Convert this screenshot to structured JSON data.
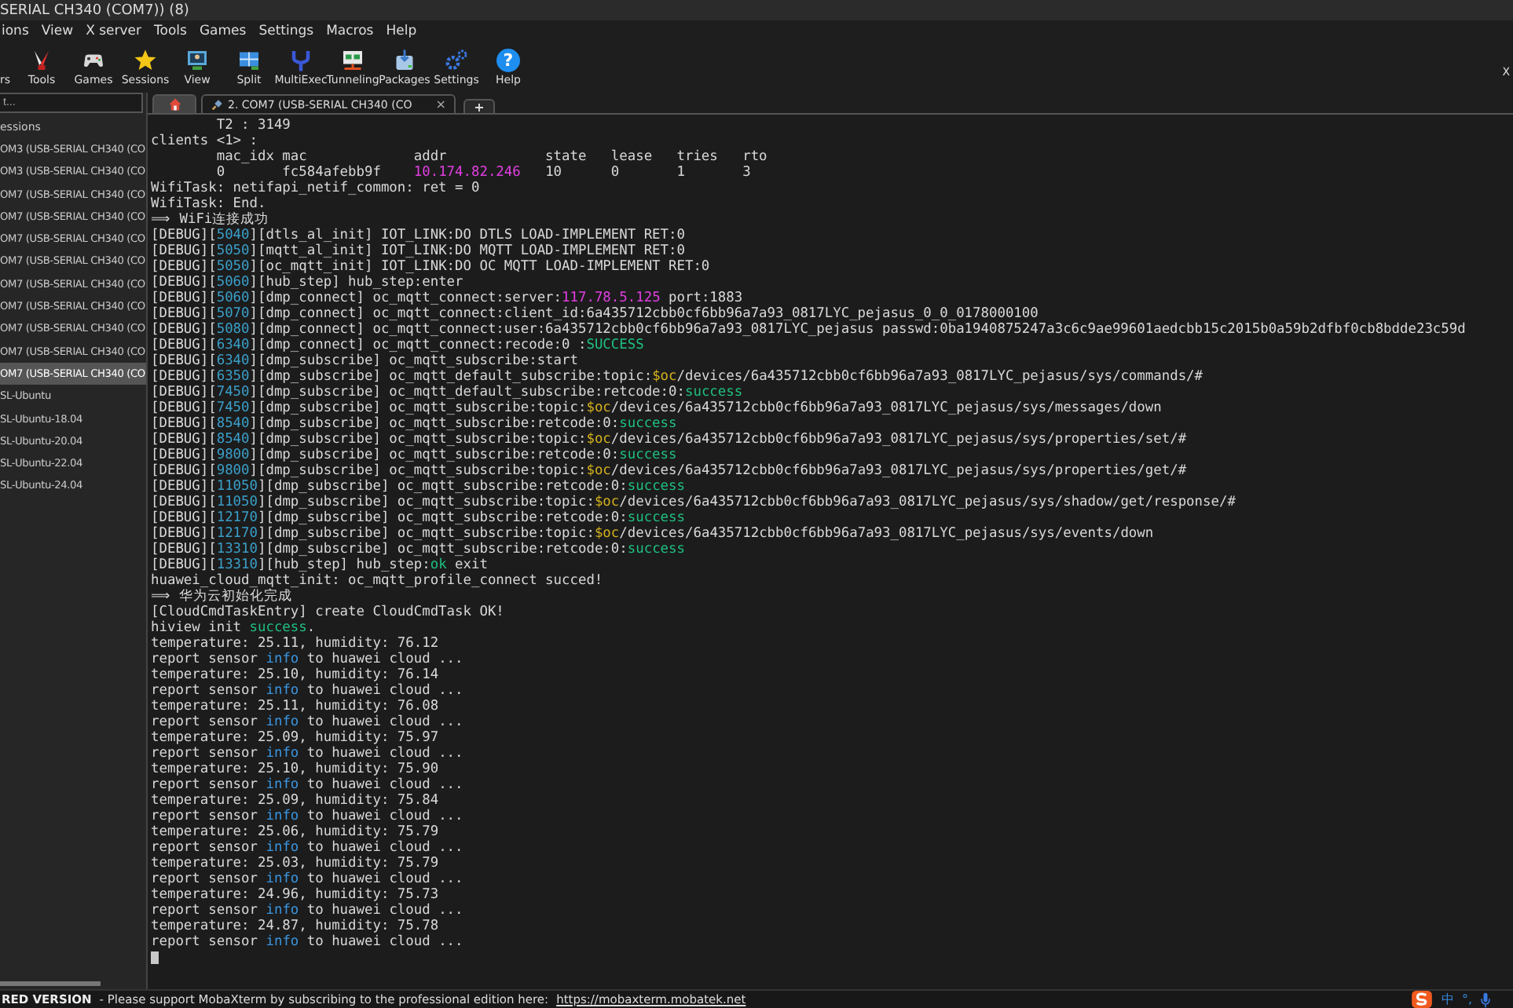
{
  "window": {
    "title": "SERIAL CH340 (COM7)) (8)"
  },
  "menu": [
    "ions",
    "View",
    "X server",
    "Tools",
    "Games",
    "Settings",
    "Macros",
    "Help"
  ],
  "toolbar": [
    {
      "label": "rs"
    },
    {
      "label": "Tools"
    },
    {
      "label": "Games"
    },
    {
      "label": "Sessions"
    },
    {
      "label": "View"
    },
    {
      "label": "Split"
    },
    {
      "label": "MultiExec"
    },
    {
      "label": "Tunneling"
    },
    {
      "label": "Packages"
    },
    {
      "label": "Settings"
    },
    {
      "label": "Help",
      "glyph": "?"
    }
  ],
  "toolbar_right": "X",
  "sidebar": {
    "search_placeholder": "t...",
    "header": "essions",
    "items": [
      {
        "label": "OM3  (USB-SERIAL CH340 (CO",
        "selected": false
      },
      {
        "label": "OM3  (USB-SERIAL CH340 (CO",
        "selected": false
      },
      {
        "label": "OM7  (USB-SERIAL CH340 (CO",
        "selected": false
      },
      {
        "label": "OM7  (USB-SERIAL CH340 (CO",
        "selected": false
      },
      {
        "label": "OM7  (USB-SERIAL CH340 (CO",
        "selected": false
      },
      {
        "label": "OM7  (USB-SERIAL CH340 (CO",
        "selected": false
      },
      {
        "label": "OM7  (USB-SERIAL CH340 (CO",
        "selected": false
      },
      {
        "label": "OM7  (USB-SERIAL CH340 (CO",
        "selected": false
      },
      {
        "label": "OM7  (USB-SERIAL CH340 (CO",
        "selected": false
      },
      {
        "label": "OM7  (USB-SERIAL CH340 (CO",
        "selected": false
      },
      {
        "label": "OM7  (USB-SERIAL CH340 (CO",
        "selected": true
      },
      {
        "label": "SL-Ubuntu",
        "selected": false
      },
      {
        "label": "SL-Ubuntu-18.04",
        "selected": false
      },
      {
        "label": "SL-Ubuntu-20.04",
        "selected": false
      },
      {
        "label": "SL-Ubuntu-22.04",
        "selected": false
      },
      {
        "label": "SL-Ubuntu-24.04",
        "selected": false
      }
    ]
  },
  "tabs": [
    {
      "kind": "home",
      "selected": false
    },
    {
      "kind": "session",
      "label": "2. COM7  (USB-SERIAL CH340 (CO",
      "close": "×",
      "selected": true
    },
    {
      "kind": "add",
      "label": "+",
      "selected": false
    }
  ],
  "terminal": {
    "lines": [
      [
        {
          "kind": "text",
          "text": "        T2 : 3149"
        }
      ],
      [
        {
          "kind": "text",
          "text": "clients <1> :"
        }
      ],
      [
        {
          "kind": "text",
          "text": "        mac_idx mac             addr            state   lease   tries   rto"
        }
      ],
      [
        {
          "kind": "text",
          "text": "        0       fc584afebb9f    "
        },
        {
          "kind": "ip",
          "text": "10.174.82.246"
        },
        {
          "kind": "text",
          "text": "   10      0       1       3"
        }
      ],
      [
        {
          "kind": "text",
          "text": "WifiTask: netifapi_netif_common: ret = 0"
        }
      ],
      [
        {
          "kind": "text",
          "text": "WifiTask: End."
        }
      ],
      [
        {
          "kind": "text",
          "text": "⟹ WiFi连接成功"
        }
      ],
      [
        {
          "kind": "text",
          "text": "[DEBUG]["
        },
        {
          "kind": "num",
          "text": "5040"
        },
        {
          "kind": "text",
          "text": "][dtls_al_init] IOT_LINK:DO DTLS LOAD-IMPLEMENT RET:0"
        }
      ],
      [
        {
          "kind": "text",
          "text": "[DEBUG]["
        },
        {
          "kind": "num",
          "text": "5050"
        },
        {
          "kind": "text",
          "text": "][mqtt_al_init] IOT_LINK:DO MQTT LOAD-IMPLEMENT RET:0"
        }
      ],
      [
        {
          "kind": "text",
          "text": "[DEBUG]["
        },
        {
          "kind": "num",
          "text": "5050"
        },
        {
          "kind": "text",
          "text": "][oc_mqtt_init] IOT_LINK:DO OC MQTT LOAD-IMPLEMENT RET:0"
        }
      ],
      [
        {
          "kind": "text",
          "text": "[DEBUG]["
        },
        {
          "kind": "num",
          "text": "5060"
        },
        {
          "kind": "text",
          "text": "][hub_step] hub_step:enter"
        }
      ],
      [
        {
          "kind": "text",
          "text": "[DEBUG]["
        },
        {
          "kind": "num",
          "text": "5060"
        },
        {
          "kind": "text",
          "text": "][dmp_connect] oc_mqtt_connect:server:"
        },
        {
          "kind": "ip",
          "text": "117.78.5.125"
        },
        {
          "kind": "text",
          "text": " port:1883"
        }
      ],
      [
        {
          "kind": "text",
          "text": "[DEBUG]["
        },
        {
          "kind": "num",
          "text": "5070"
        },
        {
          "kind": "text",
          "text": "][dmp_connect] oc_mqtt_connect:client_id:6a435712cbb0cf6bb96a7a93_0817LYC_pejasus_0_0_0178000100"
        }
      ],
      [
        {
          "kind": "text",
          "text": "[DEBUG]["
        },
        {
          "kind": "num",
          "text": "5080"
        },
        {
          "kind": "text",
          "text": "][dmp_connect] oc_mqtt_connect:user:6a435712cbb0cf6bb96a7a93_0817LYC_pejasus passwd:0ba1940875247a3c6c9ae99601aedcbb15c2015b0a59b2dfbf0cb8bdde23c59d"
        }
      ],
      [
        {
          "kind": "text",
          "text": "[DEBUG]["
        },
        {
          "kind": "num",
          "text": "6340"
        },
        {
          "kind": "text",
          "text": "][dmp_connect] oc_mqtt_connect:recode:0 :"
        },
        {
          "kind": "ok",
          "text": "SUCCESS"
        }
      ],
      [
        {
          "kind": "text",
          "text": "[DEBUG]["
        },
        {
          "kind": "num",
          "text": "6340"
        },
        {
          "kind": "text",
          "text": "][dmp_subscribe] oc_mqtt_subscribe:start"
        }
      ],
      [
        {
          "kind": "text",
          "text": "[DEBUG]["
        },
        {
          "kind": "num",
          "text": "6350"
        },
        {
          "kind": "text",
          "text": "][dmp_subscribe] oc_mqtt_default_subscribe:topic:"
        },
        {
          "kind": "topic",
          "text": "$oc"
        },
        {
          "kind": "text",
          "text": "/devices/6a435712cbb0cf6bb96a7a93_0817LYC_pejasus/sys/commands/#"
        }
      ],
      [
        {
          "kind": "text",
          "text": "[DEBUG]["
        },
        {
          "kind": "num",
          "text": "7450"
        },
        {
          "kind": "text",
          "text": "][dmp_subscribe] oc_mqtt_default_subscribe:retcode:0:"
        },
        {
          "kind": "ok",
          "text": "success"
        }
      ],
      [
        {
          "kind": "text",
          "text": "[DEBUG]["
        },
        {
          "kind": "num",
          "text": "7450"
        },
        {
          "kind": "text",
          "text": "][dmp_subscribe] oc_mqtt_subscribe:topic:"
        },
        {
          "kind": "topic",
          "text": "$oc"
        },
        {
          "kind": "text",
          "text": "/devices/6a435712cbb0cf6bb96a7a93_0817LYC_pejasus/sys/messages/down"
        }
      ],
      [
        {
          "kind": "text",
          "text": "[DEBUG]["
        },
        {
          "kind": "num",
          "text": "8540"
        },
        {
          "kind": "text",
          "text": "][dmp_subscribe] oc_mqtt_subscribe:retcode:0:"
        },
        {
          "kind": "ok",
          "text": "success"
        }
      ],
      [
        {
          "kind": "text",
          "text": "[DEBUG]["
        },
        {
          "kind": "num",
          "text": "8540"
        },
        {
          "kind": "text",
          "text": "][dmp_subscribe] oc_mqtt_subscribe:topic:"
        },
        {
          "kind": "topic",
          "text": "$oc"
        },
        {
          "kind": "text",
          "text": "/devices/6a435712cbb0cf6bb96a7a93_0817LYC_pejasus/sys/properties/set/#"
        }
      ],
      [
        {
          "kind": "text",
          "text": "[DEBUG]["
        },
        {
          "kind": "num",
          "text": "9800"
        },
        {
          "kind": "text",
          "text": "][dmp_subscribe] oc_mqtt_subscribe:retcode:0:"
        },
        {
          "kind": "ok",
          "text": "success"
        }
      ],
      [
        {
          "kind": "text",
          "text": "[DEBUG]["
        },
        {
          "kind": "num",
          "text": "9800"
        },
        {
          "kind": "text",
          "text": "][dmp_subscribe] oc_mqtt_subscribe:topic:"
        },
        {
          "kind": "topic",
          "text": "$oc"
        },
        {
          "kind": "text",
          "text": "/devices/6a435712cbb0cf6bb96a7a93_0817LYC_pejasus/sys/properties/get/#"
        }
      ],
      [
        {
          "kind": "text",
          "text": "[DEBUG]["
        },
        {
          "kind": "num",
          "text": "11050"
        },
        {
          "kind": "text",
          "text": "][dmp_subscribe] oc_mqtt_subscribe:retcode:0:"
        },
        {
          "kind": "ok",
          "text": "success"
        }
      ],
      [
        {
          "kind": "text",
          "text": "[DEBUG]["
        },
        {
          "kind": "num",
          "text": "11050"
        },
        {
          "kind": "text",
          "text": "][dmp_subscribe] oc_mqtt_subscribe:topic:"
        },
        {
          "kind": "topic",
          "text": "$oc"
        },
        {
          "kind": "text",
          "text": "/devices/6a435712cbb0cf6bb96a7a93_0817LYC_pejasus/sys/shadow/get/response/#"
        }
      ],
      [
        {
          "kind": "text",
          "text": "[DEBUG]["
        },
        {
          "kind": "num",
          "text": "12170"
        },
        {
          "kind": "text",
          "text": "][dmp_subscribe] oc_mqtt_subscribe:retcode:0:"
        },
        {
          "kind": "ok",
          "text": "success"
        }
      ],
      [
        {
          "kind": "text",
          "text": "[DEBUG]["
        },
        {
          "kind": "num",
          "text": "12170"
        },
        {
          "kind": "text",
          "text": "][dmp_subscribe] oc_mqtt_subscribe:topic:"
        },
        {
          "kind": "topic",
          "text": "$oc"
        },
        {
          "kind": "text",
          "text": "/devices/6a435712cbb0cf6bb96a7a93_0817LYC_pejasus/sys/events/down"
        }
      ],
      [
        {
          "kind": "text",
          "text": "[DEBUG]["
        },
        {
          "kind": "num",
          "text": "13310"
        },
        {
          "kind": "text",
          "text": "][dmp_subscribe] oc_mqtt_subscribe:retcode:0:"
        },
        {
          "kind": "ok",
          "text": "success"
        }
      ],
      [
        {
          "kind": "text",
          "text": "[DEBUG]["
        },
        {
          "kind": "num",
          "text": "13310"
        },
        {
          "kind": "text",
          "text": "][hub_step] hub_step:"
        },
        {
          "kind": "ok",
          "text": "ok"
        },
        {
          "kind": "text",
          "text": " exit"
        }
      ],
      [
        {
          "kind": "text",
          "text": "huawei_cloud_mqtt_init: oc_mqtt_profile_connect succed!"
        }
      ],
      [
        {
          "kind": "text",
          "text": "⟹ 华为云初始化完成"
        }
      ],
      [
        {
          "kind": "text",
          "text": "[CloudCmdTaskEntry] create CloudCmdTask OK!"
        }
      ],
      [
        {
          "kind": "text",
          "text": "hiview init "
        },
        {
          "kind": "ok",
          "text": "success"
        },
        {
          "kind": "text",
          "text": "."
        }
      ],
      [
        {
          "kind": "text",
          "text": "temperature: 25.11, humidity: 76.12"
        }
      ],
      [
        {
          "kind": "text",
          "text": "report sensor "
        },
        {
          "kind": "info",
          "text": "info"
        },
        {
          "kind": "text",
          "text": " to huawei cloud ..."
        }
      ],
      [
        {
          "kind": "text",
          "text": "temperature: 25.10, humidity: 76.14"
        }
      ],
      [
        {
          "kind": "text",
          "text": "report sensor "
        },
        {
          "kind": "info",
          "text": "info"
        },
        {
          "kind": "text",
          "text": " to huawei cloud ..."
        }
      ],
      [
        {
          "kind": "text",
          "text": "temperature: 25.11, humidity: 76.08"
        }
      ],
      [
        {
          "kind": "text",
          "text": "report sensor "
        },
        {
          "kind": "info",
          "text": "info"
        },
        {
          "kind": "text",
          "text": " to huawei cloud ..."
        }
      ],
      [
        {
          "kind": "text",
          "text": "temperature: 25.09, humidity: 75.97"
        }
      ],
      [
        {
          "kind": "text",
          "text": "report sensor "
        },
        {
          "kind": "info",
          "text": "info"
        },
        {
          "kind": "text",
          "text": " to huawei cloud ..."
        }
      ],
      [
        {
          "kind": "text",
          "text": "temperature: 25.10, humidity: 75.90"
        }
      ],
      [
        {
          "kind": "text",
          "text": "report sensor "
        },
        {
          "kind": "info",
          "text": "info"
        },
        {
          "kind": "text",
          "text": " to huawei cloud ..."
        }
      ],
      [
        {
          "kind": "text",
          "text": "temperature: 25.09, humidity: 75.84"
        }
      ],
      [
        {
          "kind": "text",
          "text": "report sensor "
        },
        {
          "kind": "info",
          "text": "info"
        },
        {
          "kind": "text",
          "text": " to huawei cloud ..."
        }
      ],
      [
        {
          "kind": "text",
          "text": "temperature: 25.06, humidity: 75.79"
        }
      ],
      [
        {
          "kind": "text",
          "text": "report sensor "
        },
        {
          "kind": "info",
          "text": "info"
        },
        {
          "kind": "text",
          "text": " to huawei cloud ..."
        }
      ],
      [
        {
          "kind": "text",
          "text": "temperature: 25.03, humidity: 75.79"
        }
      ],
      [
        {
          "kind": "text",
          "text": "report sensor "
        },
        {
          "kind": "info",
          "text": "info"
        },
        {
          "kind": "text",
          "text": " to huawei cloud ..."
        }
      ],
      [
        {
          "kind": "text",
          "text": "temperature: 24.96, humidity: 75.73"
        }
      ],
      [
        {
          "kind": "text",
          "text": "report sensor "
        },
        {
          "kind": "info",
          "text": "info"
        },
        {
          "kind": "text",
          "text": " to huawei cloud ..."
        }
      ],
      [
        {
          "kind": "text",
          "text": "temperature: 24.87, humidity: 75.78"
        }
      ],
      [
        {
          "kind": "text",
          "text": "report sensor "
        },
        {
          "kind": "info",
          "text": "info"
        },
        {
          "kind": "text",
          "text": " to huawei cloud ..."
        }
      ]
    ]
  },
  "status_bar": {
    "edition": "RED VERSION",
    "message": "-  Please support MobaXterm by subscribing to the professional edition here:",
    "link": "https://mobaxterm.mobatek.net",
    "tray": [
      "中",
      "°,"
    ]
  }
}
